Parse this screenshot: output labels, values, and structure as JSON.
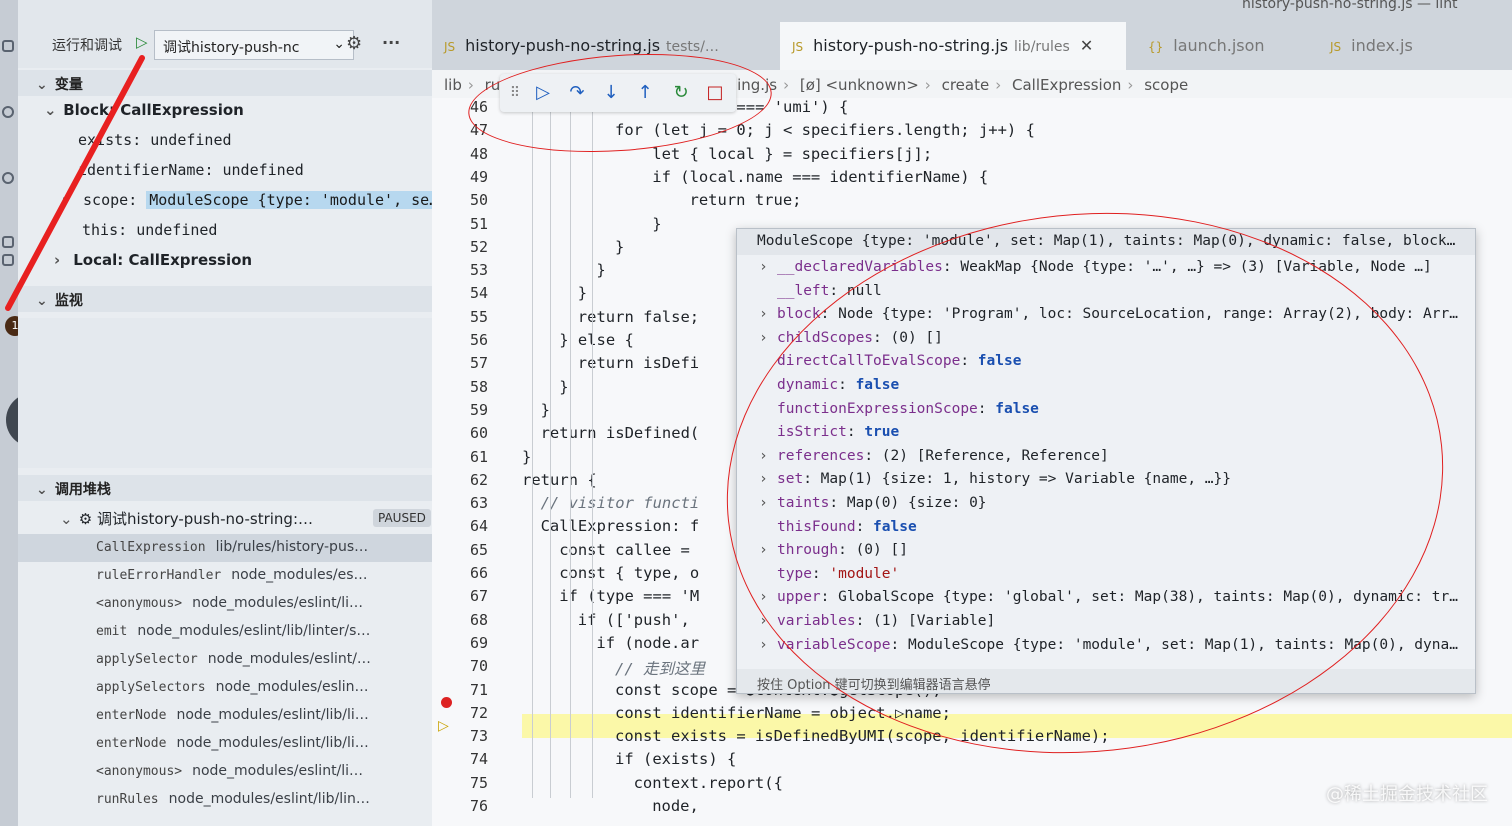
{
  "window": {
    "title": "history-push-no-string.js — lint"
  },
  "run_panel": {
    "title": "运行和调试",
    "config_name": "调试history-push-nc",
    "settings_icon": "gear-icon",
    "more_icon": "ellipsis-icon"
  },
  "variables": {
    "header": "变量",
    "block_label": "Block: CallExpression",
    "items": [
      {
        "name": "exists",
        "value": "undefined"
      },
      {
        "name": "identifierName",
        "value": "undefined"
      },
      {
        "name": "scope",
        "value": "ModuleScope {type: 'module', se…"
      },
      {
        "name": "this",
        "value": "undefined"
      }
    ],
    "local_label": "Local: CallExpression"
  },
  "watch": {
    "header": "监视"
  },
  "call_stack": {
    "header": "调用堆栈",
    "thread": "调试history-push-no-string:…",
    "status": "PAUSED",
    "frames": [
      {
        "fn": "CallExpression",
        "file": "lib/rules/history-pus…"
      },
      {
        "fn": "ruleErrorHandler",
        "file": "node_modules/es…"
      },
      {
        "fn": "<anonymous>",
        "file": "node_modules/eslint/li…"
      },
      {
        "fn": "emit",
        "file": "node_modules/eslint/lib/linter/s…"
      },
      {
        "fn": "applySelector",
        "file": "node_modules/eslint/…"
      },
      {
        "fn": "applySelectors",
        "file": "node_modules/eslin…"
      },
      {
        "fn": "enterNode",
        "file": "node_modules/eslint/lib/li…"
      },
      {
        "fn": "enterNode",
        "file": "node_modules/eslint/lib/li…"
      },
      {
        "fn": "<anonymous>",
        "file": "node_modules/eslint/li…"
      },
      {
        "fn": "runRules",
        "file": "node_modules/eslint/lib/lin…"
      }
    ]
  },
  "tabs": [
    {
      "name": "history-push-no-string.js",
      "path": "tests/…"
    },
    {
      "name": "history-push-no-string.js",
      "path": "lib/rules",
      "active": true
    },
    {
      "name": "launch.json",
      "path": ""
    },
    {
      "name": "index.js",
      "path": ""
    }
  ],
  "breadcrumb": [
    "lib",
    "ru",
    "ing.js",
    "[ø] <unknown>",
    "create",
    "CallExpression",
    "scope"
  ],
  "debug_toolbar": {
    "buttons": [
      "drag-handle-icon",
      "continue-icon",
      "step-over-icon",
      "step-into-icon",
      "step-out-icon",
      "restart-icon",
      "stop-icon"
    ]
  },
  "editor": {
    "lines": [
      {
        "n": "46",
        "text": "&& source.value === 'umi') {"
      },
      {
        "n": "47",
        "text": "for (let j = 0; j < specifiers.length; j++) {"
      },
      {
        "n": "48",
        "text": "  let { local } = specifiers[j];"
      },
      {
        "n": "49",
        "text": "  if (local.name === identifierName) {"
      },
      {
        "n": "50",
        "text": "    return true;"
      },
      {
        "n": "51",
        "text": "  }"
      },
      {
        "n": "52",
        "text": "}"
      },
      {
        "n": "53",
        "text": "}"
      },
      {
        "n": "54",
        "text": "}"
      },
      {
        "n": "55",
        "text": "return false;"
      },
      {
        "n": "56",
        "text": "} else {"
      },
      {
        "n": "57",
        "text": "return isDefi"
      },
      {
        "n": "58",
        "text": "}"
      },
      {
        "n": "59",
        "text": "}"
      },
      {
        "n": "60",
        "text": "return isDefined("
      },
      {
        "n": "61",
        "text": "}"
      },
      {
        "n": "62",
        "text": "return {"
      },
      {
        "n": "63",
        "text": "// visitor functi"
      },
      {
        "n": "64",
        "text": "CallExpression: f"
      },
      {
        "n": "65",
        "text": "const callee ="
      },
      {
        "n": "66",
        "text": "const { type, o"
      },
      {
        "n": "67",
        "text": "if (type === 'M"
      },
      {
        "n": "68",
        "text": "if (['push',"
      },
      {
        "n": "69",
        "text": "if (node.ar"
      },
      {
        "n": "70",
        "text": "// 走到这里"
      },
      {
        "n": "71",
        "text": "const scope = ●context.●getScope();"
      },
      {
        "n": "72",
        "text": "const identifierName = object.▷name;"
      },
      {
        "n": "73",
        "text": "const exists = isDefinedByUMI(scope, identifierName);"
      },
      {
        "n": "74",
        "text": "if (exists) {"
      },
      {
        "n": "75",
        "text": "context.report({"
      },
      {
        "n": "76",
        "text": "node,"
      }
    ]
  },
  "hover": {
    "title": "ModuleScope {type: 'module', set: Map(1), taints: Map(0), dynamic: false, block…",
    "props": [
      {
        "expand": true,
        "key": "__declaredVariables",
        "value": "WeakMap {Node {type: '…', …} => (3) [Variable, Node …]"
      },
      {
        "expand": false,
        "key": "__left",
        "value": "null"
      },
      {
        "expand": true,
        "key": "block",
        "value": "Node {type: 'Program', loc: SourceLocation, range: Array(2), body: Arr…"
      },
      {
        "expand": true,
        "key": "childScopes",
        "value": "(0) []"
      },
      {
        "expand": false,
        "key": "directCallToEvalScope",
        "value": "false"
      },
      {
        "expand": false,
        "key": "dynamic",
        "value": "false"
      },
      {
        "expand": false,
        "key": "functionExpressionScope",
        "value": "false"
      },
      {
        "expand": false,
        "key": "isStrict",
        "value": "true"
      },
      {
        "expand": true,
        "key": "references",
        "value": "(2) [Reference, Reference]"
      },
      {
        "expand": true,
        "key": "set",
        "value": "Map(1) {size: 1, history => Variable {name, …}}"
      },
      {
        "expand": true,
        "key": "taints",
        "value": "Map(0) {size: 0}"
      },
      {
        "expand": false,
        "key": "thisFound",
        "value": "false"
      },
      {
        "expand": true,
        "key": "through",
        "value": "(0) []"
      },
      {
        "expand": false,
        "key": "type",
        "value": "'module'"
      },
      {
        "expand": true,
        "key": "upper",
        "value": "GlobalScope {type: 'global', set: Map(38), taints: Map(0), dynamic: tr…"
      },
      {
        "expand": true,
        "key": "variables",
        "value": "(1) [Variable]"
      },
      {
        "expand": true,
        "key": "variableScope",
        "value": "ModuleScope {type: 'module', set: Map(1), taints: Map(0), dyna…"
      }
    ],
    "hint": "按住 Option 键可切换到编辑器语言悬停"
  },
  "notification_count": "1",
  "watermark": "@稀土掘金技术社区"
}
